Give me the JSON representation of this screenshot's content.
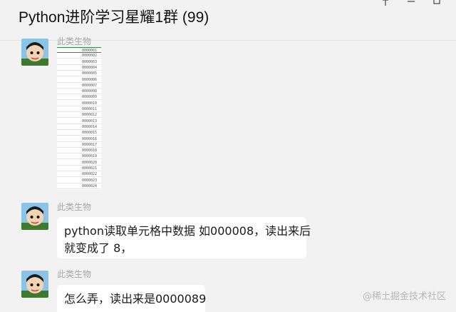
{
  "chat": {
    "title": "Python进阶学习星耀1群 (99)"
  },
  "window_controls": {
    "icons": [
      "pin-icon",
      "minimize-icon",
      "maximize-icon"
    ]
  },
  "messages": [
    {
      "sender": "此类生物",
      "type": "image",
      "image_rows": [
        "0000001",
        "0000002",
        "0000003",
        "0000004",
        "0000005",
        "0000006",
        "0000007",
        "0000008",
        "0000009",
        "0000010",
        "0000011",
        "0000012",
        "0000013",
        "0000014",
        "0000015",
        "0000016",
        "0000017",
        "0000018",
        "0000019",
        "0000020",
        "0000021",
        "0000022",
        "0000023",
        "0000024"
      ]
    },
    {
      "sender": "此类生物",
      "type": "text",
      "line1": "python读取单元格中数据 如000008，读出来后",
      "line2": "就变成了 8，"
    },
    {
      "sender": "此类生物",
      "type": "text",
      "line1": "怎么弄，读出来是0000089"
    }
  ],
  "watermark": "@稀土掘金技术社区",
  "colors": {
    "background": "#f2f2f2",
    "bubble": "#ffffff",
    "sender_name": "#a7a7a7",
    "selection": "#2b8a4a"
  }
}
